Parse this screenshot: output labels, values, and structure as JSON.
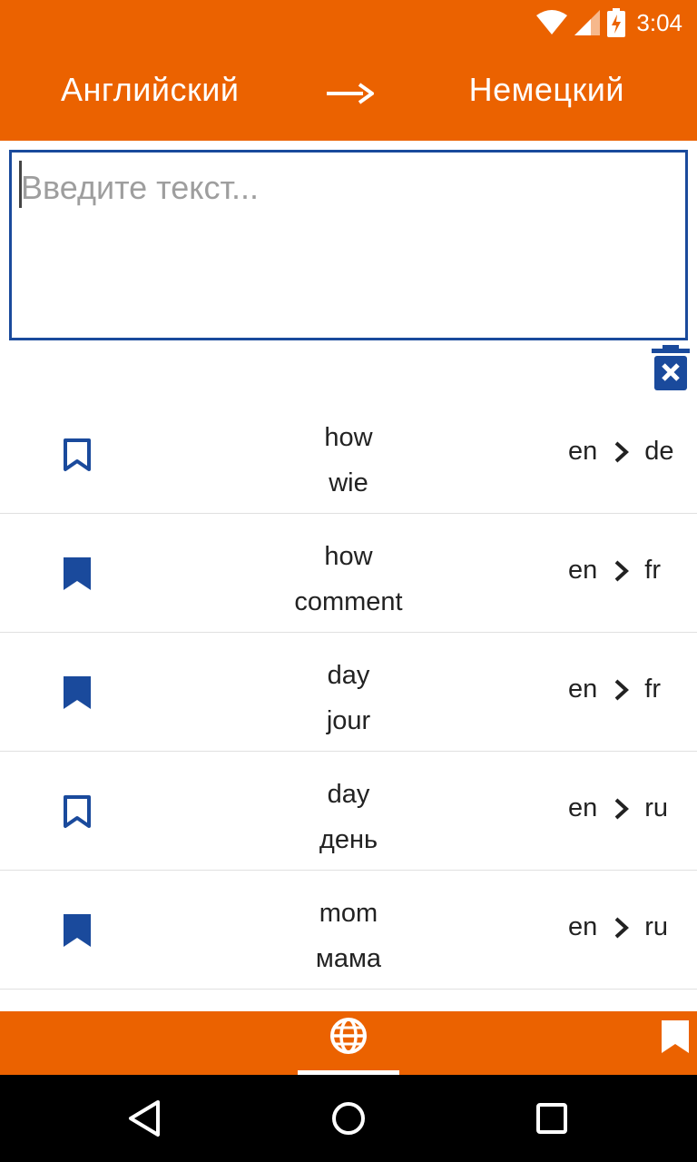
{
  "status_bar": {
    "time": "3:04",
    "icons": [
      "wifi-icon",
      "signal-icon",
      "battery-charging-icon"
    ]
  },
  "toolbar": {
    "source_language": "Английский",
    "target_language": "Немецкий",
    "swap_icon": "arrow-right-icon"
  },
  "input": {
    "placeholder": "Введите текст...",
    "value": ""
  },
  "clear_button_icon": "trash-clear-icon",
  "history": [
    {
      "source": "how",
      "translation": "wie",
      "from": "en",
      "to": "de",
      "bookmarked": false
    },
    {
      "source": "how",
      "translation": "comment",
      "from": "en",
      "to": "fr",
      "bookmarked": true
    },
    {
      "source": "day",
      "translation": "jour",
      "from": "en",
      "to": "fr",
      "bookmarked": true
    },
    {
      "source": "day",
      "translation": "день",
      "from": "en",
      "to": "ru",
      "bookmarked": false
    },
    {
      "source": "mom",
      "translation": "мама",
      "from": "en",
      "to": "ru",
      "bookmarked": true
    }
  ],
  "bottom_nav": {
    "tabs": [
      "globe-icon",
      "bookmark-icon"
    ],
    "active_tab": "globe-icon"
  },
  "colors": {
    "accent": "#eb6200",
    "primary": "#1a4a9c"
  }
}
